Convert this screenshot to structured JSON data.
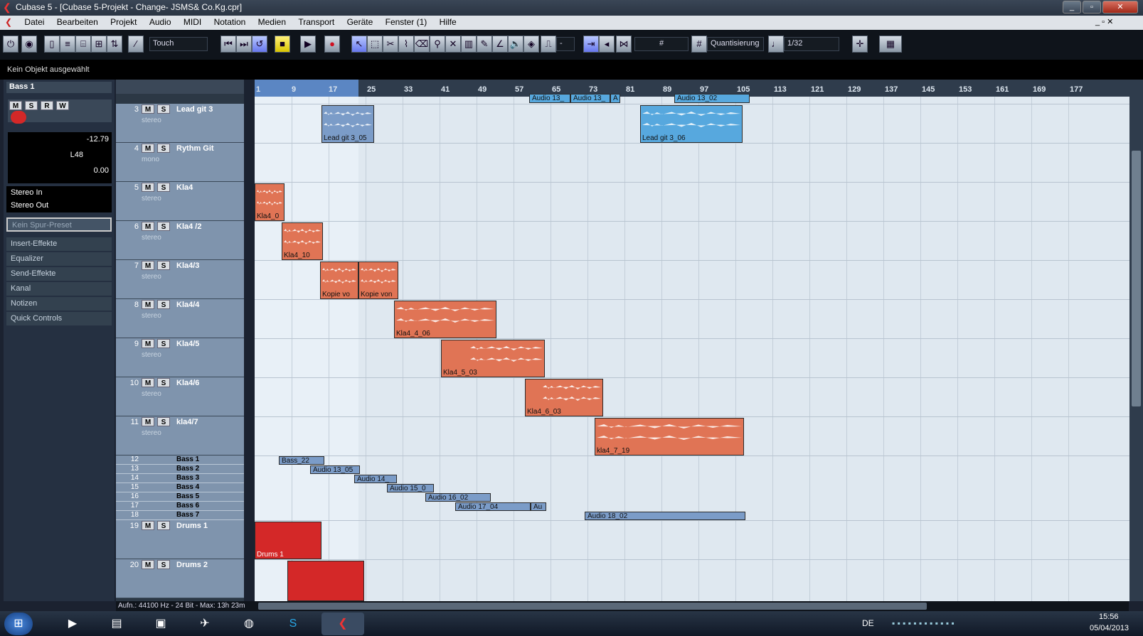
{
  "window": {
    "title": "Cubase 5 - [Cubase 5-Projekt - Change- JSMS& Co.Kg.cpr]"
  },
  "menu": [
    "Datei",
    "Bearbeiten",
    "Projekt",
    "Audio",
    "MIDI",
    "Notation",
    "Medien",
    "Transport",
    "Geräte",
    "Fenster (1)",
    "Hilfe"
  ],
  "toolbar": {
    "automation_mode": "Touch",
    "nudge": "-",
    "grid": "Quantisierung",
    "quant": "1/32"
  },
  "info_line": "Kein Objekt ausgewählt",
  "inspector": {
    "track_name": "Bass 1",
    "volume": "-12.79",
    "pan": "L48",
    "delay": "0.00",
    "input": "Stereo In",
    "output": "Stereo Out",
    "preset": "Kein Spur-Preset",
    "sections": [
      "Insert-Effekte",
      "Equalizer",
      "Send-Effekte",
      "Kanal",
      "Notizen",
      "Quick Controls"
    ]
  },
  "ruler": [
    "1",
    "9",
    "17",
    "25",
    "33",
    "41",
    "49",
    "57",
    "65",
    "73",
    "81",
    "89",
    "97",
    "105",
    "113",
    "121",
    "129",
    "137",
    "145",
    "153",
    "161",
    "169",
    "177"
  ],
  "tracks": [
    {
      "num": "3",
      "name": "Lead git 3",
      "type": "stereo"
    },
    {
      "num": "4",
      "name": "Rythm Git",
      "type": "mono"
    },
    {
      "num": "5",
      "name": "Kla4",
      "type": "stereo"
    },
    {
      "num": "6",
      "name": "Kla4 /2",
      "type": "stereo"
    },
    {
      "num": "7",
      "name": "Kla4/3",
      "type": "stereo"
    },
    {
      "num": "8",
      "name": "Kla4/4",
      "type": "stereo"
    },
    {
      "num": "9",
      "name": "Kla4/5",
      "type": "stereo"
    },
    {
      "num": "10",
      "name": "Kla4/6",
      "type": "stereo"
    },
    {
      "num": "11",
      "name": "kla4/7",
      "type": "stereo"
    }
  ],
  "small_tracks": [
    {
      "num": "12",
      "name": "Bass 1"
    },
    {
      "num": "13",
      "name": "Bass 2"
    },
    {
      "num": "14",
      "name": "Bass 3"
    },
    {
      "num": "15",
      "name": "Bass 4"
    },
    {
      "num": "16",
      "name": "Bass 5"
    },
    {
      "num": "17",
      "name": "Bass 6"
    },
    {
      "num": "18",
      "name": "Bass 7"
    }
  ],
  "drum_tracks": [
    {
      "num": "19",
      "name": "Drums 1"
    },
    {
      "num": "20",
      "name": "Drums 2"
    }
  ],
  "clips": {
    "top": [
      "Audio 13_",
      "Audio 13_",
      "A",
      "Audio 13_02"
    ],
    "lead1": "Lead git 3_05",
    "lead2": "Lead git 3_06",
    "kla4": "Kla4_0",
    "kla4_2": "Kla4_10",
    "kla4_3a": "Kopie vo",
    "kla4_3b": "Kopie von",
    "kla4_4": "Kla4_4_06",
    "kla4_5": "Kla4_5_03",
    "kla4_6": "Kla4_6_03",
    "kla4_7": "kla4_7_19",
    "bass": [
      "Bass_22",
      "Audio 13_05",
      "Audio 14_",
      "Audio 15_0",
      "Audio 16_02",
      "Audio 17_04",
      "Au",
      "Audio 18_02"
    ],
    "drums1": "Drums 1"
  },
  "status": "Aufn.: 44100 Hz - 24 Bit - Max: 13h 23m",
  "taskbar": {
    "lang": "DE",
    "time": "15:56",
    "date": "05/04/2013"
  }
}
